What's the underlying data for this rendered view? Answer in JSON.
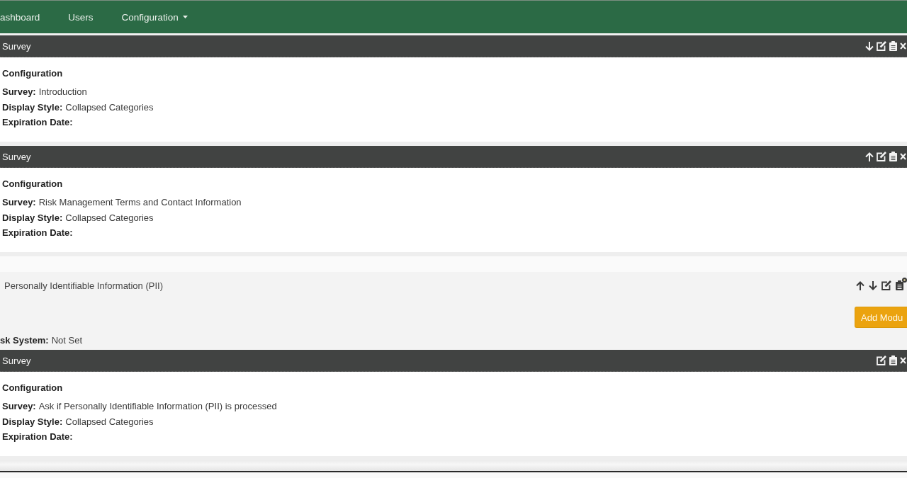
{
  "nav": {
    "items": [
      {
        "label": "ashboard",
        "dropdown": false
      },
      {
        "label": "Users",
        "dropdown": false
      },
      {
        "label": "Configuration",
        "dropdown": true
      }
    ]
  },
  "sections": [
    {
      "kind": "survey",
      "title": "Survey",
      "can_move_up": false,
      "can_move_down": true,
      "can_delete": true,
      "heading": "Configuration",
      "fields": [
        {
          "label": "Survey:",
          "value": "Introduction"
        },
        {
          "label": "Display Style:",
          "value": "Collapsed Categories"
        },
        {
          "label": "Expiration Date:"
        }
      ]
    },
    {
      "kind": "survey",
      "title": "Survey",
      "can_move_up": true,
      "can_move_down": false,
      "can_delete": true,
      "heading": "Configuration",
      "fields": [
        {
          "label": "Survey:",
          "value": "Risk Management Terms and Contact Information"
        },
        {
          "label": "Display Style:",
          "value": "Collapsed Categories"
        },
        {
          "label": "Expiration Date:"
        }
      ]
    },
    {
      "kind": "module",
      "title": "Personally Identifiable Information (PII)",
      "can_move_up": true,
      "can_move_down": true,
      "button": "Add Modu",
      "fields": [
        {
          "label": "sk System:",
          "value": "Not Set"
        }
      ]
    },
    {
      "kind": "survey",
      "title": "Survey",
      "can_move_up": false,
      "can_move_down": false,
      "can_delete": true,
      "heading": "Configuration",
      "fields": [
        {
          "label": "Survey:",
          "value": "Ask if Personally Identifiable Information (PII) is processed"
        },
        {
          "label": "Display Style:",
          "value": "Collapsed Categories"
        },
        {
          "label": "Expiration Date:"
        }
      ]
    }
  ]
}
